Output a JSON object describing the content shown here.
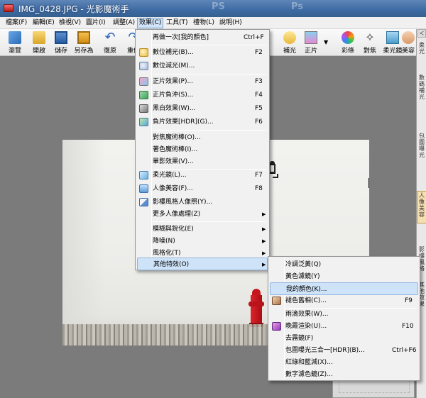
{
  "window": {
    "title": "IMG_0428.JPG - 光影魔術手",
    "title_ghost_1": "PS",
    "title_ghost_2": "Ps"
  },
  "menubar": [
    {
      "label": "檔案(F)",
      "name": "menu-file"
    },
    {
      "label": "編輯(E)",
      "name": "menu-edit"
    },
    {
      "label": "檢視(V)",
      "name": "menu-view"
    },
    {
      "label": "圖片(I)",
      "name": "menu-image"
    },
    {
      "label": "調整(A)",
      "name": "menu-adjust"
    },
    {
      "label": "效果(C)",
      "name": "menu-effects"
    },
    {
      "label": "工具(T)",
      "name": "menu-tools"
    },
    {
      "label": "禮物(L)",
      "name": "menu-gifts"
    },
    {
      "label": "說明(H)",
      "name": "menu-help"
    }
  ],
  "toolbar": {
    "browse": "瀏覽",
    "open": "開啟",
    "save": "儲存",
    "save_as": "另存為",
    "undo": "復原",
    "redo": "重做",
    "fill_light": "補光",
    "film": "正片",
    "tint": "彩條",
    "focus": "對焦",
    "soft_focus": "柔光鏡",
    "beauty": "美容"
  },
  "right_panel": {
    "segments": [
      "＜",
      "柔光",
      "數碼補光",
      "包圍曝光",
      "人像美容",
      "影樓風格",
      "其他效果"
    ]
  },
  "effects_menu": {
    "items": [
      {
        "label": "再做一次[我的顏色]",
        "shortcut": "Ctrl+F",
        "icon": ""
      },
      {
        "label": "數位補光(B)...",
        "shortcut": "F2",
        "icon": "fill-light"
      },
      {
        "label": "數位減光(M)...",
        "shortcut": "",
        "icon": "reduce-light"
      },
      {
        "label": "正片效果(P)...",
        "shortcut": "F3",
        "icon": "film"
      },
      {
        "label": "正片負沖(S)...",
        "shortcut": "F4",
        "icon": "cross-process"
      },
      {
        "label": "黑白效果(W)...",
        "shortcut": "F5",
        "icon": "black-white"
      },
      {
        "label": "負片效果[HDR](G)...",
        "shortcut": "F6",
        "icon": "hdr"
      },
      {
        "label": "對焦魔術棒(O)...",
        "shortcut": "",
        "icon": ""
      },
      {
        "label": "著色魔術棒(I)...",
        "shortcut": "",
        "icon": ""
      },
      {
        "label": "暈影效果(V)...",
        "shortcut": "",
        "icon": ""
      },
      {
        "label": "柔光鏡(L)...",
        "shortcut": "F7",
        "icon": "soft-focus"
      },
      {
        "label": "人像美容(F)...",
        "shortcut": "F8",
        "icon": "portrait-beauty"
      },
      {
        "label": "影樓風格人像照(Y)...",
        "shortcut": "",
        "icon": "studio-portrait"
      },
      {
        "label": "更多人像處理(Z)",
        "shortcut": "",
        "icon": "",
        "submenu": true
      },
      {
        "label": "模糊與銳化(E)",
        "shortcut": "",
        "icon": "",
        "submenu": true
      },
      {
        "label": "降噪(N)",
        "shortcut": "",
        "icon": "",
        "submenu": true
      },
      {
        "label": "風格化(T)",
        "shortcut": "",
        "icon": "",
        "submenu": true
      },
      {
        "label": "其他特效(O)",
        "shortcut": "",
        "icon": "",
        "submenu": true,
        "highlighted": true
      }
    ]
  },
  "other_effects_menu": {
    "items": [
      {
        "label": "冷調泛黃(Q)",
        "shortcut": "",
        "icon": ""
      },
      {
        "label": "黃色濾鏡(Y)",
        "shortcut": "",
        "icon": ""
      },
      {
        "label": "我的顏色(K)...",
        "shortcut": "",
        "icon": "",
        "highlighted": true
      },
      {
        "label": "褪色舊相(C)...",
        "shortcut": "F9",
        "icon": "faded-photo"
      },
      {
        "label": "雨滴效果(W)...",
        "shortcut": "",
        "icon": ""
      },
      {
        "label": "晚霞渲染(U)...",
        "shortcut": "F10",
        "icon": "sunset"
      },
      {
        "label": "去霧鏡(F)",
        "shortcut": "",
        "icon": ""
      },
      {
        "label": "包圍曝光三合一[HDR](B)...",
        "shortcut": "Ctrl+F6",
        "icon": ""
      },
      {
        "label": "紅綠和藍減(X)...",
        "shortcut": "",
        "icon": ""
      },
      {
        "label": "數字濾色鏡(Z)...",
        "shortcut": "",
        "icon": ""
      }
    ]
  }
}
